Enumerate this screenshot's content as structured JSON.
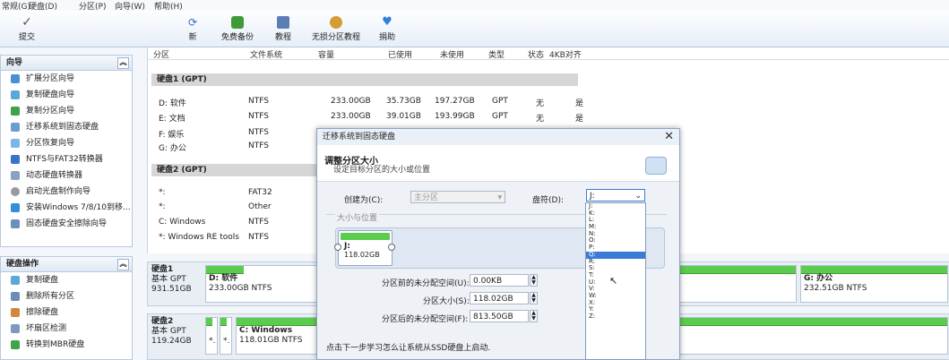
{
  "menu": [
    "常规(G)",
    "硬盘(D)",
    "分区(P)",
    "向导(W)",
    "帮助(H)"
  ],
  "toolbar": {
    "submit": "提交",
    "refresh": "新",
    "backup": "免费备份",
    "tutorial": "教程",
    "lossless": "无损分区教程",
    "donate": "捐助"
  },
  "wizard_panel": {
    "title": "向导",
    "items": [
      "扩展分区向导",
      "复制硬盘向导",
      "复制分区向导",
      "迁移系统到固态硬盘",
      "分区恢复向导",
      "NTFS与FAT32转换器",
      "动态硬盘转换器",
      "启动光盘制作向导",
      "安装Windows 7/8/10到移...",
      "固态硬盘安全擦除向导"
    ]
  },
  "disk_ops_panel": {
    "title": "硬盘操作",
    "items": [
      "复制硬盘",
      "删除所有分区",
      "擦除硬盘",
      "坏扇区检测",
      "转换到MBR硬盘"
    ]
  },
  "table": {
    "headers": [
      "分区",
      "文件系统",
      "容量",
      "已使用",
      "未使用",
      "类型",
      "状态",
      "4KB对齐"
    ],
    "disk1_label": "硬盘1 (GPT)",
    "disk1_rows": [
      [
        "D: 软件",
        "NTFS",
        "233.00GB",
        "35.73GB",
        "197.27GB",
        "GPT",
        "无",
        "是"
      ],
      [
        "E: 文档",
        "NTFS",
        "233.00GB",
        "39.01GB",
        "193.99GB",
        "GPT",
        "无",
        "是"
      ],
      [
        "F: 娱乐",
        "NTFS",
        "",
        "",
        "",
        "",
        "",
        ""
      ],
      [
        "G: 办公",
        "NTFS",
        "",
        "",
        "",
        "",
        "",
        ""
      ]
    ],
    "disk2_label": "硬盘2 (GPT)",
    "disk2_rows": [
      [
        "*:",
        "FAT32"
      ],
      [
        "*:",
        "Other"
      ],
      [
        "C: Windows",
        "NTFS"
      ],
      [
        "*: Windows RE tools",
        "NTFS"
      ]
    ]
  },
  "disk_map": {
    "disk1": {
      "name": "硬盘1",
      "type": "基本 GPT",
      "size": "931.51GB",
      "p1_name": "D: 软件",
      "p1_info": "233.00GB NTFS",
      "p4_name": "G: 办公",
      "p4_info": "232.51GB NTFS"
    },
    "disk2": {
      "name": "硬盘2",
      "type": "基本 GPT",
      "size": "119.24GB",
      "p_small1": "*.",
      "p_small2": "*.",
      "p3_name": "C: Windows",
      "p3_info": "118.01GB NTFS"
    }
  },
  "dialog": {
    "title": "迁移系统到固态硬盘",
    "heading": "调整分区大小",
    "subheading": "设定目标分区的大小或位置",
    "create_as_label": "创建为(C):",
    "create_as_value": "主分区",
    "drive_letter_label": "盘符(D):",
    "drive_letter_value": "J:",
    "size_group_label": "大小与位置",
    "partition_name": "J:",
    "partition_size": "118.02GB",
    "before_label": "分区前的未分配空间(U):",
    "before_value": "0.00KB",
    "size_label": "分区大小(S):",
    "size_value": "118.02GB",
    "after_label": "分区后的未分配空间(F):",
    "after_value": "813.50GB",
    "hint": "点击下一步学习怎么让系统从SSD硬盘上启动."
  },
  "drive_options": [
    "J:",
    "K:",
    "L:",
    "M:",
    "N:",
    "O:",
    "P:",
    "Q:",
    "R:",
    "S:",
    "T:",
    "U:",
    "V:",
    "W:",
    "X:",
    "Y:",
    "Z:"
  ],
  "drive_selected_index": 7,
  "colors": {
    "partition_bar": "#5ccc4e",
    "selection": "#3a7bd5",
    "group_header": "#d6d6d6"
  }
}
